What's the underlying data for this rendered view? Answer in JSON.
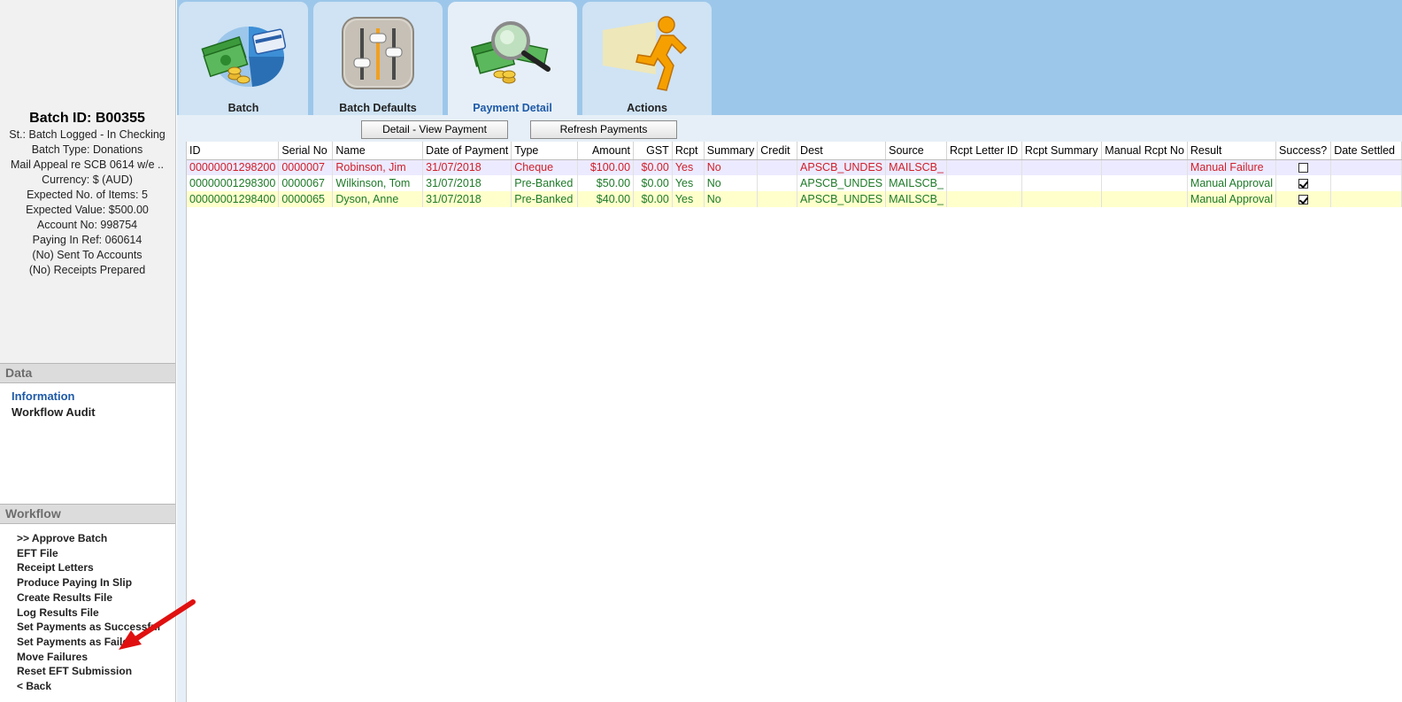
{
  "sidebar": {
    "batch_title": "Batch ID: B00355",
    "info_lines": [
      "St.: Batch Logged - In Checking",
      "Batch Type: Donations",
      "Mail Appeal re SCB 0614 w/e ..",
      "Currency: $ (AUD)",
      "Expected No. of Items: 5",
      "Expected Value: $500.00",
      "Account No: 998754",
      "Paying In Ref: 060614",
      "(No) Sent To Accounts",
      "(No) Receipts Prepared"
    ],
    "data_section": {
      "title": "Data",
      "items": [
        "Information",
        "Workflow Audit"
      ]
    },
    "workflow_section": {
      "title": "Workflow",
      "items": [
        ">> Approve Batch",
        "EFT File",
        "Receipt Letters",
        "Produce Paying In Slip",
        "Create Results File",
        "Log Results File",
        "Set Payments as Successful",
        "Set Payments as Failed",
        "Move Failures",
        "Reset EFT Submission",
        "< Back"
      ]
    }
  },
  "tabs": [
    {
      "label": "Batch",
      "icon": "batch-money-pie-icon"
    },
    {
      "label": "Batch Defaults",
      "icon": "sliders-icon"
    },
    {
      "label": "Payment Detail",
      "icon": "magnifier-money-icon"
    },
    {
      "label": "Actions",
      "icon": "running-man-icon"
    }
  ],
  "toolbar": {
    "detail_label": "Detail - View Payment",
    "refresh_label": "Refresh Payments"
  },
  "grid": {
    "columns": [
      "ID",
      "Serial No",
      "Name",
      "Date of Payment",
      "Type",
      "Amount",
      "GST",
      "Rcpt",
      "Summary",
      "Credit",
      "Dest",
      "Source",
      "Rcpt Letter ID",
      "Rcpt Summary",
      "Manual Rcpt No",
      "Result",
      "Success?",
      "Date Settled"
    ],
    "rows": [
      {
        "id": "00000001298200",
        "serial": "0000007",
        "name": "Robinson, Jim",
        "date": "31/07/2018",
        "type": "Cheque",
        "amount": "$100.00",
        "gst": "$0.00",
        "rcpt": "Yes",
        "summary": "No",
        "credit": "",
        "dest": "APSCB_UNDES",
        "source": "MAILSCB_",
        "rcpt_letter_id": "",
        "rcpt_summary": "",
        "manual_rcpt_no": "",
        "result": "Manual Failure",
        "success": false,
        "date_settled": ""
      },
      {
        "id": "00000001298300",
        "serial": "0000067",
        "name": "Wilkinson, Tom",
        "date": "31/07/2018",
        "type": "Pre-Banked",
        "amount": "$50.00",
        "gst": "$0.00",
        "rcpt": "Yes",
        "summary": "No",
        "credit": "",
        "dest": "APSCB_UNDES",
        "source": "MAILSCB_",
        "rcpt_letter_id": "",
        "rcpt_summary": "",
        "manual_rcpt_no": "",
        "result": "Manual Approval",
        "success": true,
        "date_settled": ""
      },
      {
        "id": "00000001298400",
        "serial": "0000065",
        "name": "Dyson, Anne",
        "date": "31/07/2018",
        "type": "Pre-Banked",
        "amount": "$40.00",
        "gst": "$0.00",
        "rcpt": "Yes",
        "summary": "No",
        "credit": "",
        "dest": "APSCB_UNDES",
        "source": "MAILSCB_",
        "rcpt_letter_id": "",
        "rcpt_summary": "",
        "manual_rcpt_no": "",
        "result": "Manual Approval",
        "success": true,
        "date_settled": ""
      }
    ]
  },
  "colors": {
    "topbar_bg": "#9dc7ea",
    "tab_bg": "#cfe3f4",
    "active_tab_text": "#1e5aa8",
    "failure_text": "#d0202a",
    "approval_text": "#1e7a28",
    "annotation_arrow": "#e01010"
  }
}
